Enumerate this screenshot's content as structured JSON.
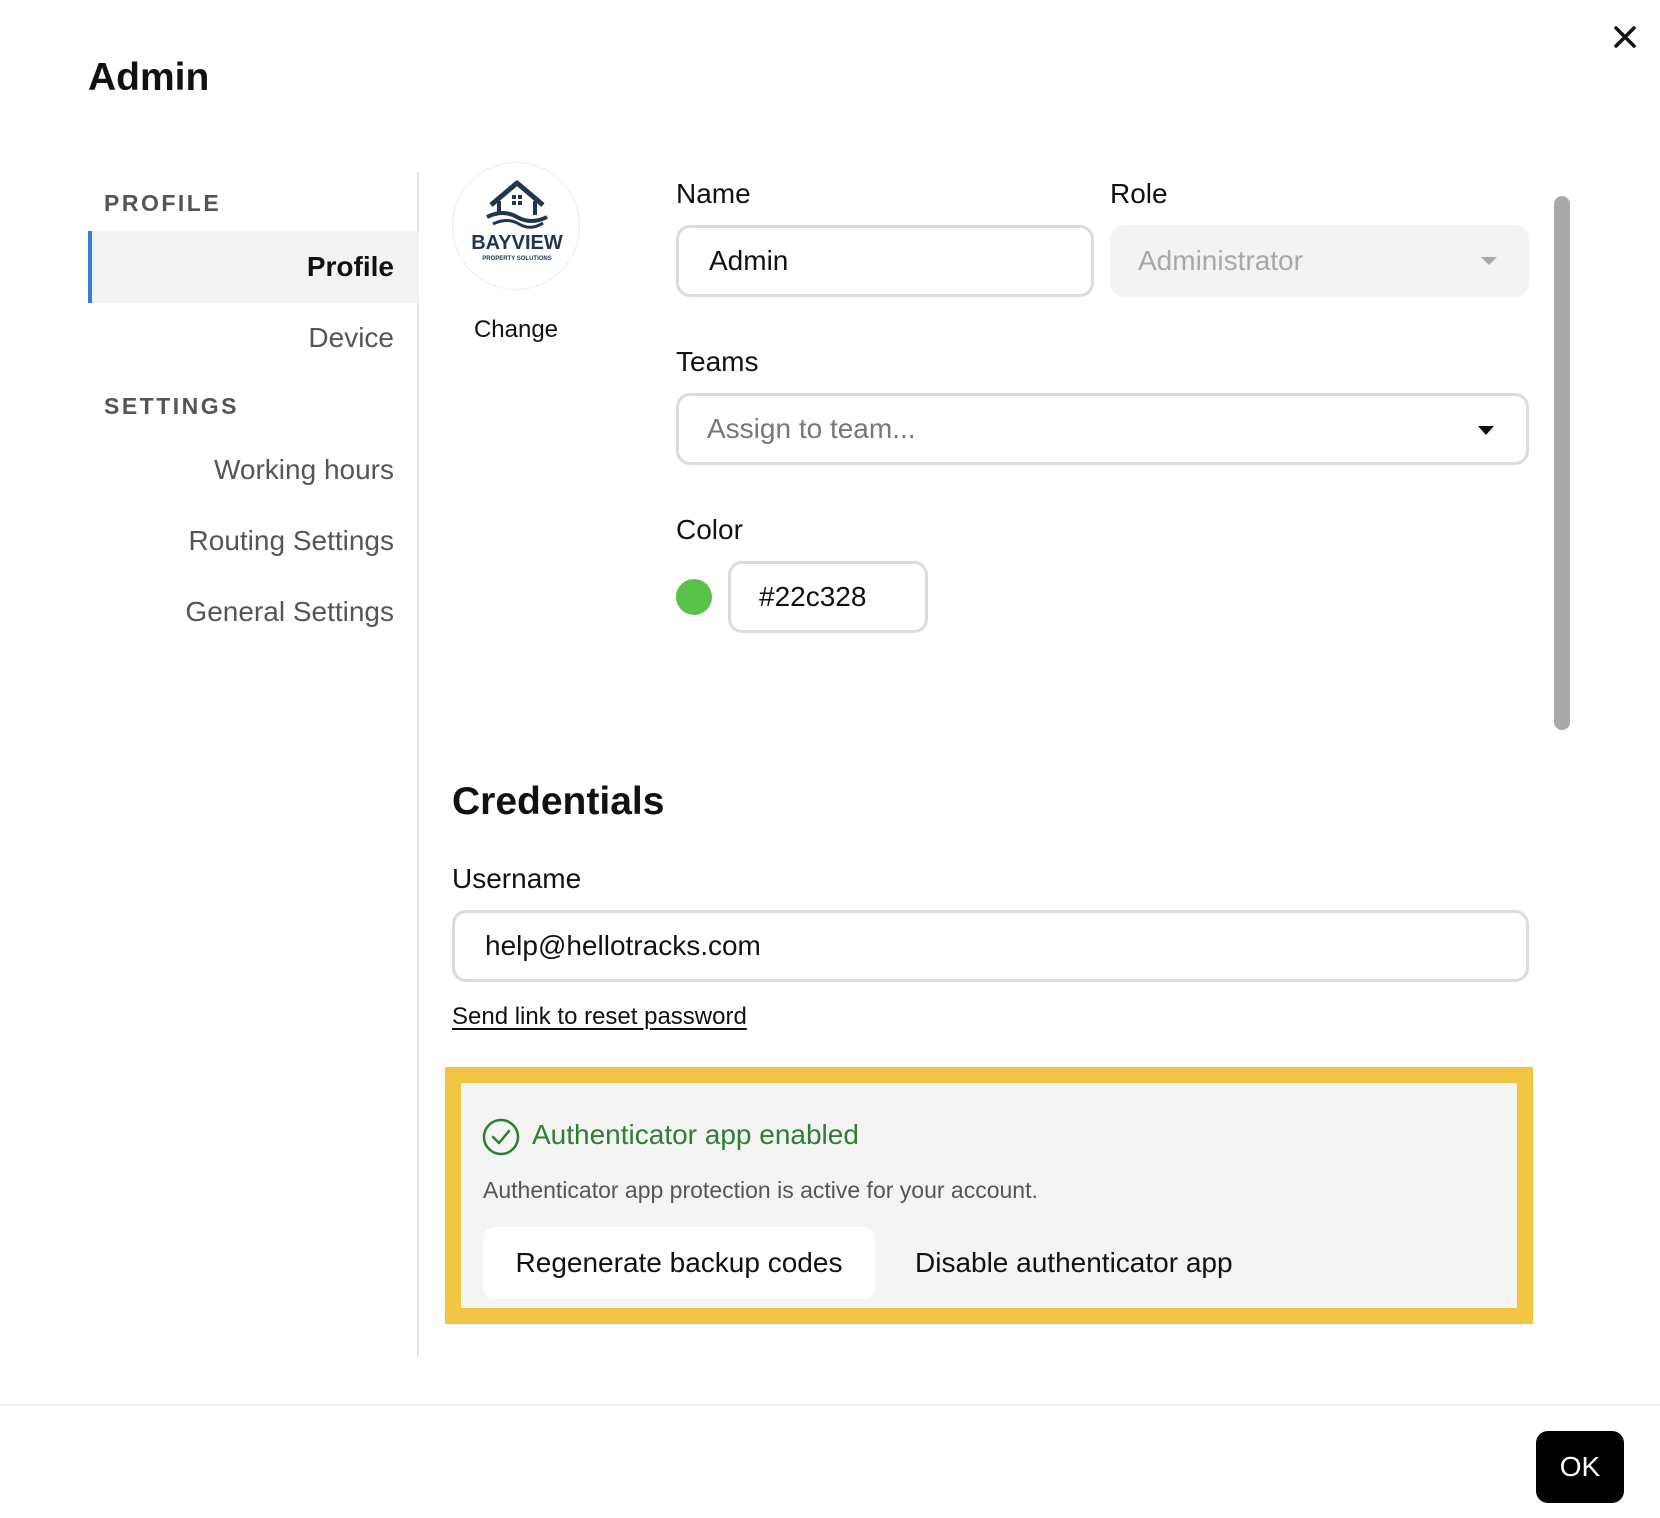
{
  "dialog": {
    "title": "Admin",
    "ok_label": "OK"
  },
  "sidebar": {
    "profile_header": "PROFILE",
    "settings_header": "SETTINGS",
    "items": [
      {
        "label": "Profile",
        "active": true
      },
      {
        "label": "Device"
      },
      {
        "label": "Working hours"
      },
      {
        "label": "Routing Settings"
      },
      {
        "label": "General Settings"
      }
    ],
    "accent_color": "#3a7bd5"
  },
  "avatar": {
    "brand": "BAYVIEW",
    "tagline": "PROPERTY SOLUTIONS",
    "change_label": "Change"
  },
  "profile": {
    "name_label": "Name",
    "name_value": "Admin",
    "role_label": "Role",
    "role_value": "Administrator",
    "teams_label": "Teams",
    "teams_placeholder": "Assign to team...",
    "color_label": "Color",
    "color_value": "#22c328",
    "swatch_color": "#5ac14b"
  },
  "credentials": {
    "title": "Credentials",
    "username_label": "Username",
    "username_value": "help@hellotracks.com",
    "reset_link": "Send link to reset password"
  },
  "mfa": {
    "status": "Authenticator app enabled",
    "description": "Authenticator app protection is active for your account.",
    "regen_label": "Regenerate backup codes",
    "disable_label": "Disable authenticator app",
    "highlight_color": "#f2c443",
    "status_color": "#2e7d32"
  }
}
